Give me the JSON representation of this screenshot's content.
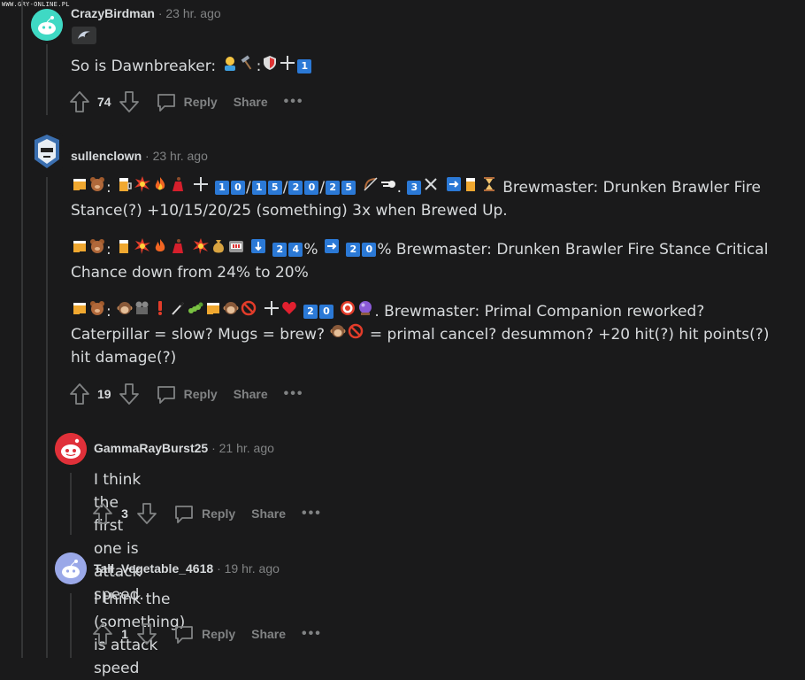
{
  "watermark": "WWW.GRY-ONLINE.PL",
  "comments": [
    {
      "author": "CrazyBirdman",
      "time": "23 hr. ago",
      "body": [
        "So is Dawnbreaker: "
      ],
      "votes": "74",
      "reply": "Reply",
      "share": "Share",
      "more": "•••"
    },
    {
      "author": "sullenclown",
      "time": "23 hr. ago",
      "body": [
        "Brewmaster: Drunken Brawler Fire Stance(?) +10/15/20/25 (something) 3x when Brewed Up.",
        "Brewmaster: Drunken Brawler Fire Stance Critical Chance down from 24% to 20%",
        "Brewmaster: Primal Companion reworked? Caterpillar = slow? Mugs = brew? ",
        "= primal cancel? desummon? +20 hit(?) hit points(?) hit damage(?)"
      ],
      "votes": "19",
      "reply": "Reply",
      "share": "Share",
      "more": "•••"
    },
    {
      "author": "GammaRayBurst25",
      "time": "21 hr. ago",
      "body": [
        "I think the first one is attack speed."
      ],
      "votes": "3",
      "reply": "Reply",
      "share": "Share",
      "more": "•••"
    },
    {
      "author": "Tall_Vegetable_4618",
      "time": "19 hr. ago",
      "body": [
        "I think the (something) is attack speed"
      ],
      "votes": "1",
      "reply": "Reply",
      "share": "Share",
      "more": "•••"
    }
  ],
  "keycaps": {
    "one": "1",
    "zero": "0",
    "two": "2",
    "five": "5",
    "three": "3",
    "four": "4"
  },
  "symbols": {
    "slash": "/",
    "percent": "%",
    "colon": ":",
    "period": "."
  },
  "colors": {
    "background": "#1a1a1b",
    "text": "#d7dadc",
    "muted": "#818384",
    "keycap": "#2b79d6"
  }
}
